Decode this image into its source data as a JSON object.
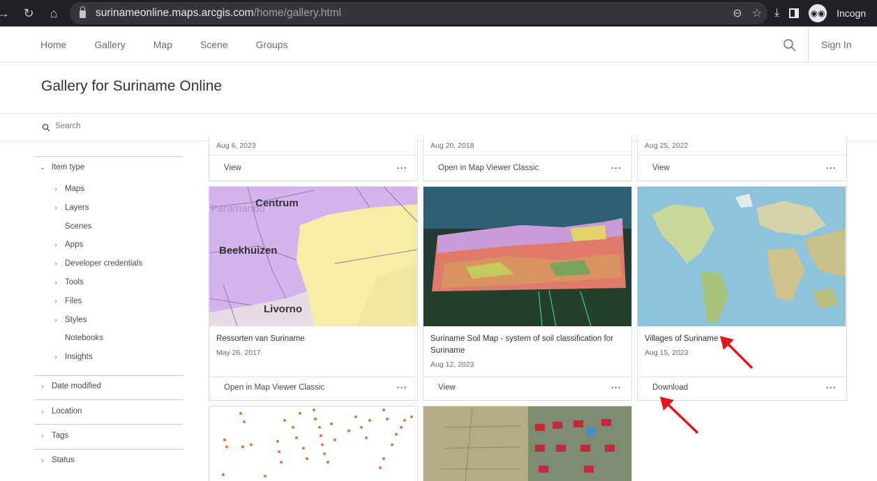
{
  "browser": {
    "url_host": "surinameonline.maps.arcgis.com",
    "url_path": "/home/gallery.html",
    "profile_label": "Incogn"
  },
  "topnav": {
    "links": [
      "Home",
      "Gallery",
      "Map",
      "Scene",
      "Groups"
    ],
    "signin": "Sign In"
  },
  "page": {
    "title": "Gallery for Suriname Online",
    "search_placeholder": "Search"
  },
  "sidebar": {
    "item_type": "Item type",
    "subitems": [
      "Maps",
      "Layers",
      "Scenes",
      "Apps",
      "Developer credentials",
      "Tools",
      "Files",
      "Styles",
      "Notebooks",
      "Insights"
    ],
    "filters": [
      "Date modified",
      "Location",
      "Tags",
      "Status"
    ]
  },
  "cards_top": [
    {
      "date": "Aug 6, 2023",
      "action": "View"
    },
    {
      "date": "Aug 20, 2018",
      "action": "Open in Map Viewer Classic"
    },
    {
      "date": "Aug 25, 2022",
      "action": "View"
    }
  ],
  "cards": [
    {
      "title": "Ressorten van Suriname",
      "date": "May 26, 2017",
      "action": "Open in Map Viewer Classic",
      "thumb_labels": [
        "Paramaribo",
        "Centrum",
        "Beekhuizen",
        "Livorno"
      ]
    },
    {
      "title": "Suriname Soil Map - system of soil classification for Suriname",
      "date": "Aug 12, 2023",
      "action": "View"
    },
    {
      "title": "Villages of Suriname",
      "date": "Aug 15, 2023",
      "action": "Download"
    }
  ],
  "more_label": "···",
  "colors": {
    "annotation_arrow": "#e3141b",
    "accent": "#0079c1"
  }
}
